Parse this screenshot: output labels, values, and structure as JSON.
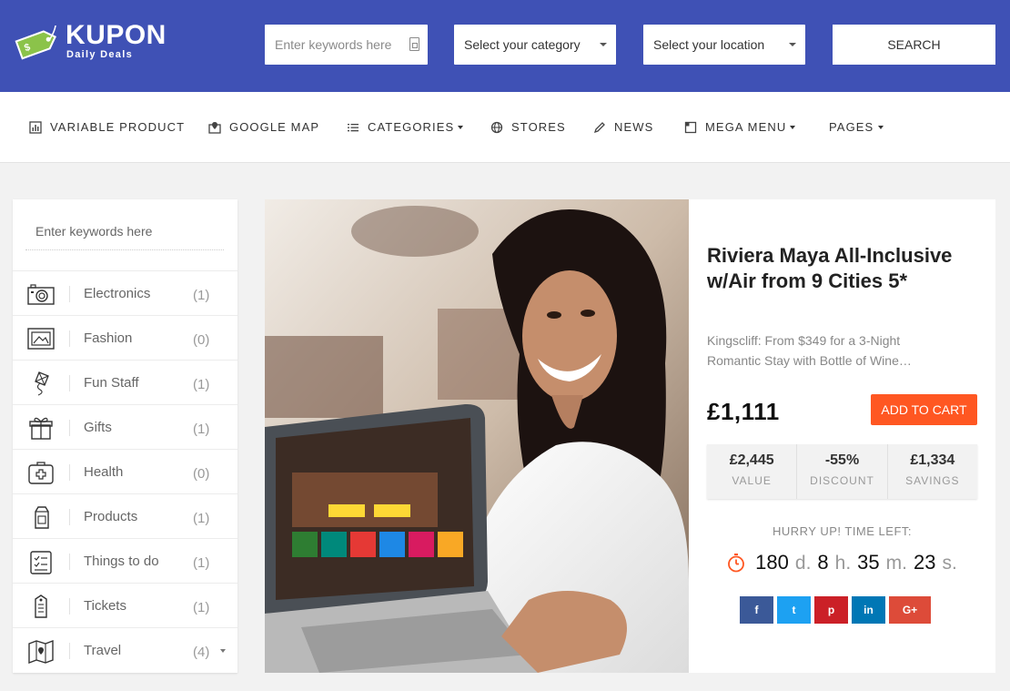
{
  "header": {
    "brand": "KUPON",
    "tagline": "Daily Deals",
    "keywords_placeholder": "Enter keywords here",
    "category_select": "Select your category",
    "location_select": "Select your location",
    "search_label": "SEARCH"
  },
  "nav": {
    "items": [
      {
        "label": "VARIABLE PRODUCT",
        "icon": "chart-icon"
      },
      {
        "label": "GOOGLE MAP",
        "icon": "map-marker-icon"
      },
      {
        "label": "CATEGORIES",
        "icon": "list-icon"
      },
      {
        "label": "STORES",
        "icon": "globe-icon"
      },
      {
        "label": "NEWS",
        "icon": "pencil-icon"
      },
      {
        "label": "MEGA MENU",
        "icon": "layout-icon"
      },
      {
        "label": "PAGES",
        "icon": ""
      }
    ]
  },
  "sidebar": {
    "search_placeholder": "Enter keywords here",
    "categories": [
      {
        "label": "Electronics",
        "count": "(1)",
        "icon": "camera-icon"
      },
      {
        "label": "Fashion",
        "count": "(0)",
        "icon": "picture-icon"
      },
      {
        "label": "Fun Staff",
        "count": "(1)",
        "icon": "kite-icon"
      },
      {
        "label": "Gifts",
        "count": "(1)",
        "icon": "gift-icon"
      },
      {
        "label": "Health",
        "count": "(0)",
        "icon": "first-aid-icon"
      },
      {
        "label": "Products",
        "count": "(1)",
        "icon": "milk-carton-icon"
      },
      {
        "label": "Things to do",
        "count": "(1)",
        "icon": "checklist-icon"
      },
      {
        "label": "Tickets",
        "count": "(1)",
        "icon": "ticket-icon"
      },
      {
        "label": "Travel",
        "count": "(4)",
        "icon": "map-icon"
      }
    ]
  },
  "deal": {
    "title": "Riviera Maya All-Inclusive w/Air from 9 Cities 5*",
    "description": "Kingscliff: From $349 for a 3-Night Romantic Stay with Bottle of Wine…",
    "price": "£1,111",
    "add_to_cart": "ADD TO CART",
    "stats": [
      {
        "value": "£2,445",
        "label": "VALUE"
      },
      {
        "value": "-55%",
        "label": "DISCOUNT"
      },
      {
        "value": "£1,334",
        "label": "SAVINGS"
      }
    ],
    "hurry_text": "HURRY UP! TIME LEFT:",
    "timer": {
      "days": "180",
      "days_unit": "d.",
      "hours": "8",
      "hours_unit": "h.",
      "minutes": "35",
      "minutes_unit": "m.",
      "seconds": "23",
      "seconds_unit": "s."
    },
    "social": [
      {
        "label": "f",
        "color": "#3b5998",
        "icon": "facebook-icon"
      },
      {
        "label": "t",
        "color": "#1da1f2",
        "icon": "twitter-icon"
      },
      {
        "label": "p",
        "color": "#cb2027",
        "icon": "pinterest-icon"
      },
      {
        "label": "in",
        "color": "#0077b5",
        "icon": "linkedin-icon"
      },
      {
        "label": "G+",
        "color": "#dd4b39",
        "icon": "google-plus-icon"
      }
    ]
  },
  "colors": {
    "header_bg": "#3f51b5",
    "accent": "#ff5722",
    "logo_tag": "#8bc34a"
  }
}
